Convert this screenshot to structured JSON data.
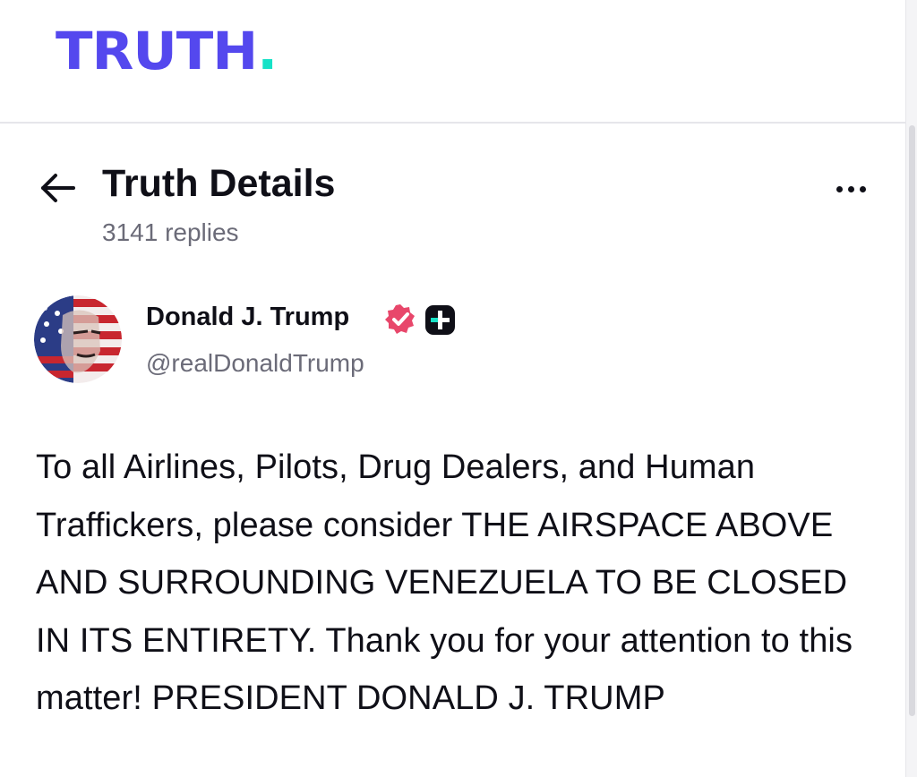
{
  "app": {
    "logo_text": "TRUTH",
    "logo_dot": ".",
    "brand_color": "#5448ee",
    "accent_color": "#17e2c7"
  },
  "details_header": {
    "back_icon": "arrow-left-icon",
    "title": "Truth Details",
    "replies": "3141 replies",
    "more_icon": "more-horizontal-icon"
  },
  "author": {
    "name": "Donald J. Trump",
    "handle": "@realDonaldTrump",
    "verified_icon": "verified-badge-icon",
    "verified_color": "#e8476b",
    "plus_icon": "truth-plus-badge-icon"
  },
  "post": {
    "text": "To all Airlines, Pilots, Drug Dealers, and Human Traffickers, please consider THE AIRSPACE ABOVE AND SURROUNDING VENEZUELA TO BE CLOSED IN ITS ENTIRETY. Thank you for your attention to this matter! PRESIDENT DONALD J. TRUMP"
  }
}
